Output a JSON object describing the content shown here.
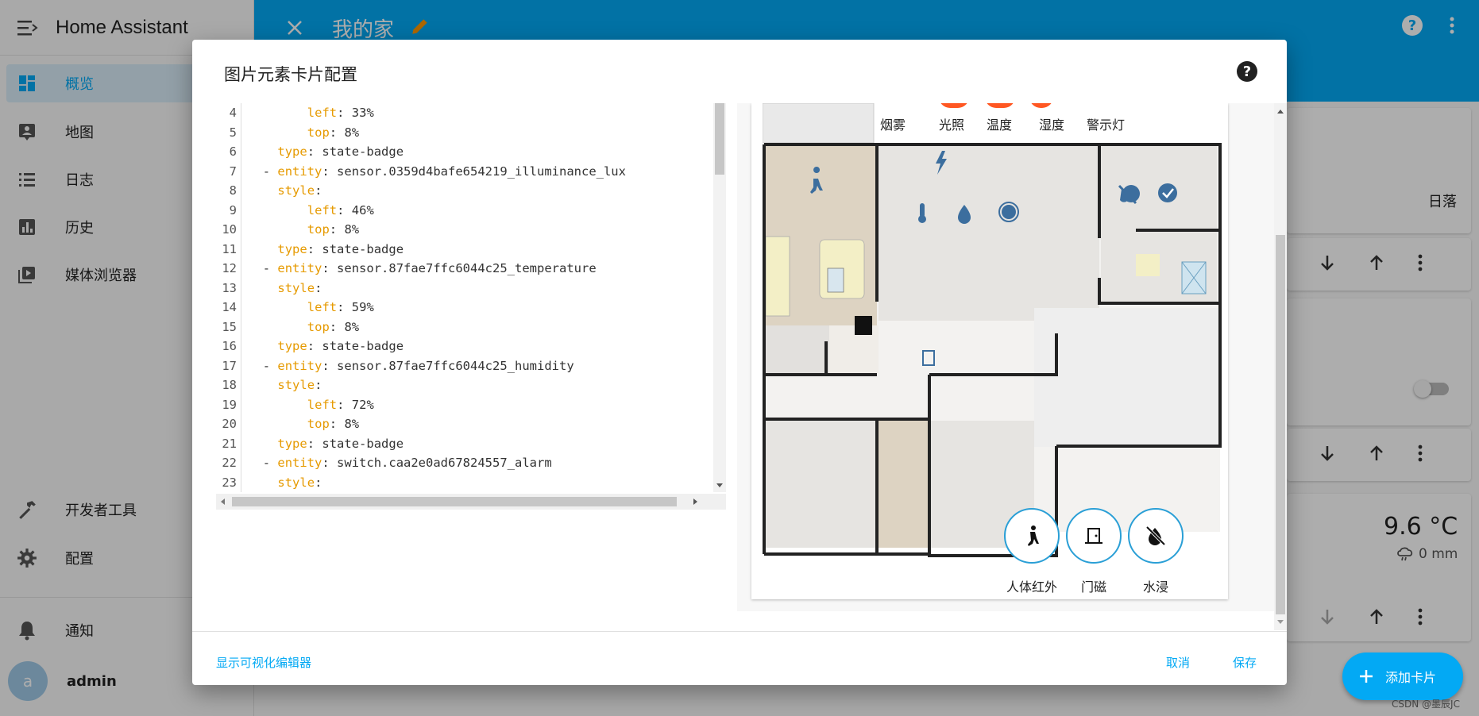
{
  "sidebar": {
    "title": "Home Assistant",
    "items": [
      {
        "label": "概览",
        "icon": "dashboard-icon"
      },
      {
        "label": "地图",
        "icon": "map-account-icon"
      },
      {
        "label": "日志",
        "icon": "list-icon"
      },
      {
        "label": "历史",
        "icon": "chart-box-icon"
      },
      {
        "label": "媒体浏览器",
        "icon": "play-box-icon"
      }
    ],
    "bottom_items": [
      {
        "label": "开发者工具",
        "icon": "hammer-icon"
      },
      {
        "label": "配置",
        "icon": "gear-icon"
      },
      {
        "label": "通知",
        "icon": "bell-icon"
      }
    ],
    "user": {
      "initial": "a",
      "name": "admin"
    }
  },
  "appbar": {
    "title": "我的家"
  },
  "background": {
    "sunset_label": "日落",
    "temperature": "9.6 °C",
    "rain": "0 mm",
    "fab_label": "添加卡片",
    "watermark": "CSDN @墨辰JC"
  },
  "dialog": {
    "title": "图片元素卡片配置",
    "code_lines": [
      {
        "n": "4",
        "indent": 4,
        "key": "left",
        "val": " 33%",
        "dash": false
      },
      {
        "n": "5",
        "indent": 4,
        "key": "top",
        "val": " 8%",
        "dash": false
      },
      {
        "n": "6",
        "indent": 2,
        "key": "type",
        "val": " state-badge",
        "dash": false
      },
      {
        "n": "7",
        "indent": 1,
        "key": "entity",
        "val": " sensor.0359d4bafe654219_illuminance_lux",
        "dash": true
      },
      {
        "n": "8",
        "indent": 2,
        "key": "style",
        "val": "",
        "dash": false
      },
      {
        "n": "9",
        "indent": 4,
        "key": "left",
        "val": " 46%",
        "dash": false
      },
      {
        "n": "10",
        "indent": 4,
        "key": "top",
        "val": " 8%",
        "dash": false
      },
      {
        "n": "11",
        "indent": 2,
        "key": "type",
        "val": " state-badge",
        "dash": false
      },
      {
        "n": "12",
        "indent": 1,
        "key": "entity",
        "val": " sensor.87fae7ffc6044c25_temperature",
        "dash": true
      },
      {
        "n": "13",
        "indent": 2,
        "key": "style",
        "val": "",
        "dash": false
      },
      {
        "n": "14",
        "indent": 4,
        "key": "left",
        "val": " 59%",
        "dash": false
      },
      {
        "n": "15",
        "indent": 4,
        "key": "top",
        "val": " 8%",
        "dash": false
      },
      {
        "n": "16",
        "indent": 2,
        "key": "type",
        "val": " state-badge",
        "dash": false
      },
      {
        "n": "17",
        "indent": 1,
        "key": "entity",
        "val": " sensor.87fae7ffc6044c25_humidity",
        "dash": true
      },
      {
        "n": "18",
        "indent": 2,
        "key": "style",
        "val": "",
        "dash": false
      },
      {
        "n": "19",
        "indent": 4,
        "key": "left",
        "val": " 72%",
        "dash": false
      },
      {
        "n": "20",
        "indent": 4,
        "key": "top",
        "val": " 8%",
        "dash": false
      },
      {
        "n": "21",
        "indent": 2,
        "key": "type",
        "val": " state-badge",
        "dash": false
      },
      {
        "n": "22",
        "indent": 1,
        "key": "entity",
        "val": " switch.caa2e0ad67824557_alarm",
        "dash": true
      },
      {
        "n": "23",
        "indent": 2,
        "key": "style",
        "val": "",
        "dash": false
      }
    ],
    "badges": [
      "烟雾",
      "光照",
      "温度",
      "湿度",
      "警示灯"
    ],
    "sensor_buttons": [
      {
        "label": "人体红外",
        "icon": "motion-sensor-icon"
      },
      {
        "label": "门磁",
        "icon": "door-icon"
      },
      {
        "label": "水浸",
        "icon": "water-off-icon"
      }
    ],
    "show_visual_editor": "显示可视化编辑器",
    "cancel": "取消",
    "save": "保存"
  },
  "colors": {
    "primary": "#03a9f4",
    "accent": "#ff5722",
    "code_key": "#e69a00"
  }
}
